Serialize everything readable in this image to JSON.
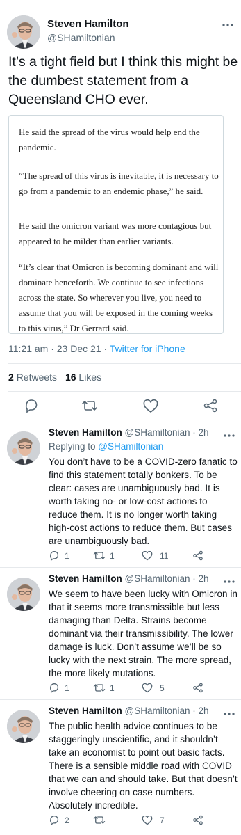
{
  "main_tweet": {
    "author_name": "Steven Hamilton",
    "handle": "@SHamiltonian",
    "text": "It’s a tight field but I think this might be the dumbest statement from a Queensland CHO ever.",
    "quote_paragraphs": [
      "He said the spread of the virus would help end the pandemic.",
      "“The spread of this virus is inevitable, it is necessary to go from a pandemic to an endemic phase,” he said.",
      "He said the omicron variant was more contagious but appeared to be milder than earlier variants.",
      "“It’s clear that Omicron is becoming dominant and will dominate henceforth. We continue to see infections across the state. So wherever you live, you need to assume that you will be exposed in the coming weeks to this virus,” Dr Gerrard said."
    ],
    "timestamp": "11:21 am · 23 Dec 21 · ",
    "source": "Twitter for iPhone",
    "retweets_count": "2",
    "retweets_label": "Retweets",
    "likes_count": "16",
    "likes_label": "Likes"
  },
  "replies": [
    {
      "author_name": "Steven Hamilton",
      "handle_time": "@SHamiltonian · 2h",
      "replying_prefix": "Replying to ",
      "replying_handle": "@SHamiltonian",
      "text": "You don’t have to be a COVID-zero fanatic to find this statement totally bonkers. To be clear: cases are unambiguously bad. It is worth taking no- or low-cost actions to reduce them. It is no longer worth taking high-cost actions to reduce them. But cases are unambiguously bad.",
      "reply_count": "1",
      "retweet_count": "1",
      "like_count": "11"
    },
    {
      "author_name": "Steven Hamilton",
      "handle_time": "@SHamiltonian · 2h",
      "text": "We seem to have been lucky with Omicron in that it seems more transmissible but less damaging than Delta. Strains become dominant via their transmissibility. The lower damage is luck. Don’t assume we’ll be so lucky with the next strain. The more spread, the more likely mutations.",
      "reply_count": "1",
      "retweet_count": "1",
      "like_count": "5"
    },
    {
      "author_name": "Steven Hamilton",
      "handle_time": "@SHamiltonian · 2h",
      "text": "The public health advice continues to be staggeringly unscientific, and it shouldn’t take an economist to point out basic facts. There is a sensible middle road with COVID that we can and should take. But that doesn’t involve cheering on case numbers. Absolutely incredible.",
      "reply_count": "2",
      "retweet_count": "",
      "like_count": "7"
    }
  ],
  "icons": [
    "more-icon",
    "comment-icon",
    "retweet-icon",
    "like-icon",
    "share-icon"
  ],
  "colors": {
    "accent": "#1d9bf0",
    "text": "#0f1419",
    "secondary": "#536471",
    "border": "#cfd9de"
  }
}
